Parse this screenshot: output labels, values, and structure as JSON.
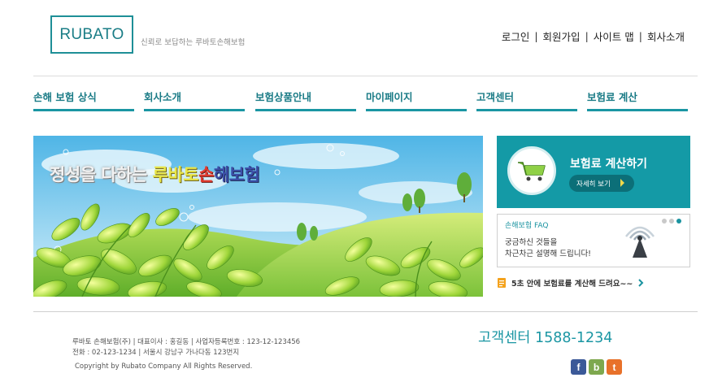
{
  "header": {
    "logo": "RUBATO",
    "tagline": "신뢰로 보답하는 루바토손해보험",
    "util_nav": [
      "로그인",
      "회원가입",
      "사이트 맵",
      "회사소개"
    ],
    "separator": "|"
  },
  "gnb": {
    "items": [
      "손해 보험 상식",
      "회사소개",
      "보험상품안내",
      "마이페이지",
      "고객센터",
      "보험료 계산"
    ],
    "accent_color": "#1a96a3"
  },
  "banner": {
    "title_parts": [
      "정성을 다하는 ",
      "루바토",
      "손",
      "해보험"
    ]
  },
  "calc_box": {
    "title": "보험료 계산하기",
    "button": "자세히 보기",
    "icon": "shopping-cart-icon",
    "bg_color": "#149aa6"
  },
  "faq": {
    "title": "손해보험 FAQ",
    "lines": [
      "궁금하신 것들을",
      "차근차근 설명해 드립니다!"
    ],
    "icon": "broadcast-tower-icon",
    "slide_count": 3,
    "active_slide": 3
  },
  "notice": {
    "text": "5초 안에 보험료를 계산해 드려요~~",
    "icon": "document-icon"
  },
  "footer": {
    "lines": [
      "루바토 손해보험(주) | 대표이사 : 홍길동 | 사업자등록번호 : 123-12-123456",
      "전화 : 02-123-1234 | 서울시 강남구 가나다동 123번지",
      "Copyright by Rubato Company All Rights Reserved."
    ],
    "customer_center": "고객센터  1588-1234",
    "social": [
      {
        "label": "f",
        "icon": "facebook-icon",
        "color": "#3b5998"
      },
      {
        "label": "b",
        "icon": "blog-icon",
        "color": "#7ea84e"
      },
      {
        "label": "t",
        "icon": "twitter-icon",
        "color": "#e8712a"
      }
    ]
  }
}
